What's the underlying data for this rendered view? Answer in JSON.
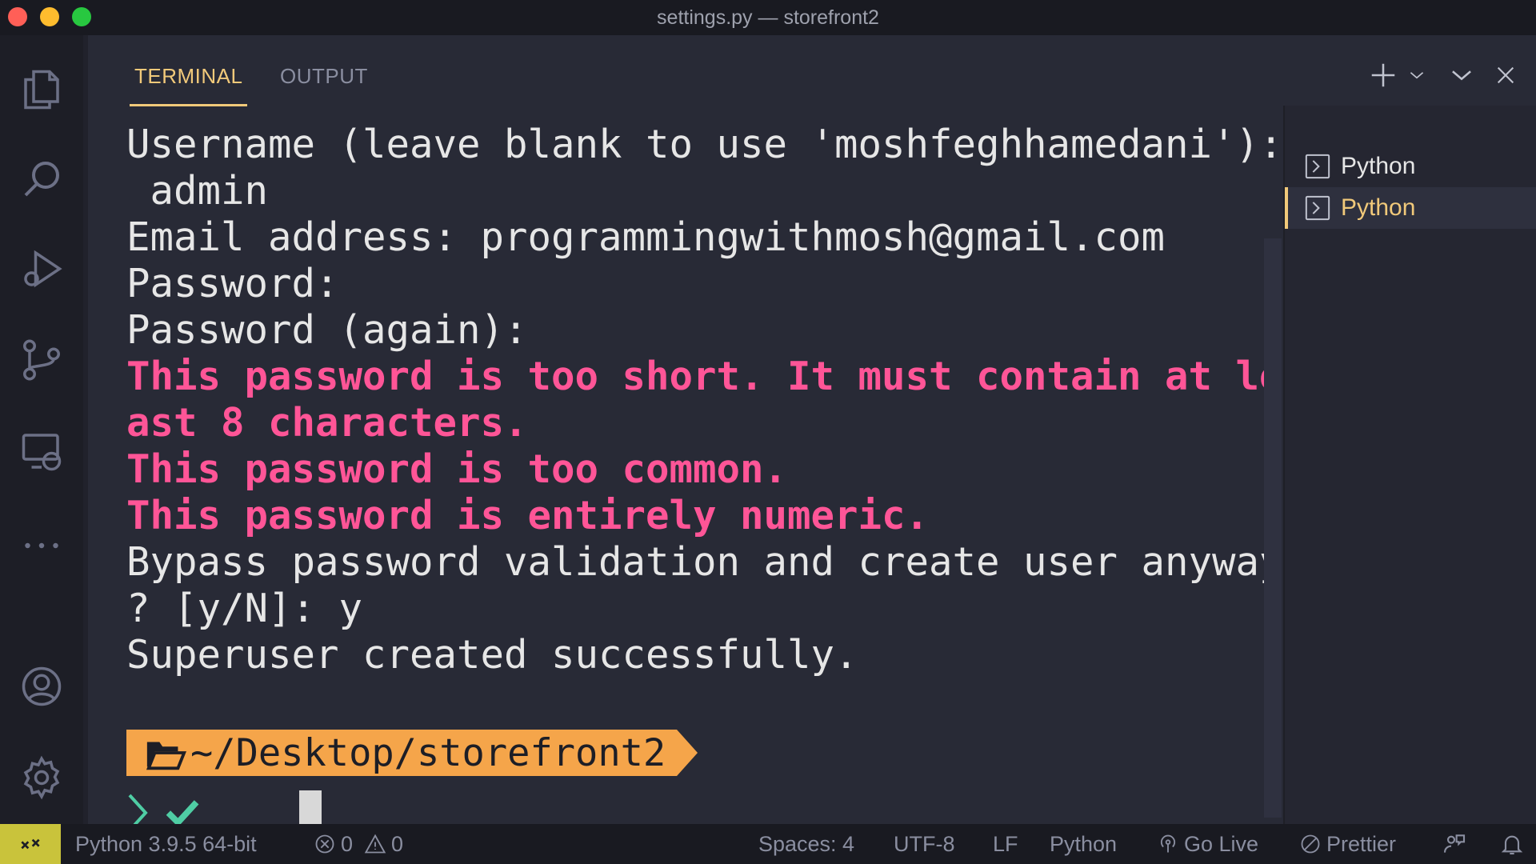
{
  "window": {
    "title": "settings.py — storefront2"
  },
  "activity_bar": {
    "icons": [
      "files-icon",
      "search-icon",
      "run-debug-icon",
      "source-control-icon",
      "remote-explorer-icon",
      "more-icon",
      "account-icon",
      "settings-gear-icon"
    ]
  },
  "panel": {
    "tabs": [
      {
        "label": "TERMINAL",
        "active": true
      },
      {
        "label": "OUTPUT",
        "active": false
      }
    ],
    "actions": [
      "plus-icon",
      "chevron-down-icon",
      "chevron-down-icon",
      "close-icon"
    ]
  },
  "terminal": {
    "lines": [
      {
        "text": "Username (leave blank to use 'moshfeghhamedani'):",
        "kind": "normal"
      },
      {
        "text": " admin",
        "kind": "normal"
      },
      {
        "text": "Email address: programmingwithmosh@gmail.com",
        "kind": "normal"
      },
      {
        "text": "Password:",
        "kind": "normal"
      },
      {
        "text": "Password (again):",
        "kind": "normal"
      },
      {
        "text": "This password is too short. It must contain at le",
        "kind": "error"
      },
      {
        "text": "ast 8 characters.",
        "kind": "error"
      },
      {
        "text": "This password is too common.",
        "kind": "error"
      },
      {
        "text": "This password is entirely numeric.",
        "kind": "error"
      },
      {
        "text": "Bypass password validation and create user anyway",
        "kind": "normal"
      },
      {
        "text": "? [y/N]: y",
        "kind": "normal"
      },
      {
        "text": "Superuser created successfully.",
        "kind": "normal"
      }
    ],
    "prompt_path": "~/Desktop/storefront2",
    "error_color": "#ff5597",
    "prompt_color": "#f5a54a"
  },
  "terminal_list": {
    "items": [
      {
        "label": "Python",
        "active": false
      },
      {
        "label": "Python",
        "active": true
      }
    ]
  },
  "status_bar": {
    "interpreter": "Python 3.9.5 64-bit",
    "errors": "0",
    "warnings": "0",
    "spaces": "Spaces: 4",
    "encoding": "UTF-8",
    "eol": "LF",
    "language": "Python",
    "go_live": "Go Live",
    "prettier": "Prettier"
  },
  "colors": {
    "accent": "#f1c97a",
    "remote": "#c9c33b"
  }
}
